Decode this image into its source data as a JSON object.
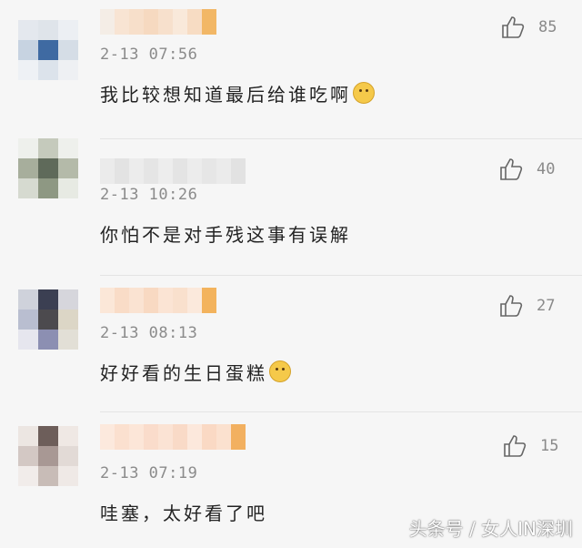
{
  "comments": [
    {
      "timestamp": "2-13 07:56",
      "text": "我比较想知道最后给谁吃啊",
      "likes": "85",
      "emoji": "doge-emoji"
    },
    {
      "timestamp": "2-13 10:26",
      "text": "你怕不是对手残这事有误解",
      "likes": "40",
      "emoji": ""
    },
    {
      "timestamp": "2-13 08:13",
      "text": "好好看的生日蛋糕",
      "likes": "27",
      "emoji": "blush-emoji"
    },
    {
      "timestamp": "2-13 07:19",
      "text": "哇塞，太好看了吧",
      "likes": "15",
      "emoji": ""
    }
  ],
  "watermark": "头条号 / 女人IN深圳",
  "icons": {
    "like": "thumbs-up-icon"
  },
  "colors": {
    "background": "#f6f6f6",
    "text": "#232323",
    "meta": "#8b8b8b"
  }
}
